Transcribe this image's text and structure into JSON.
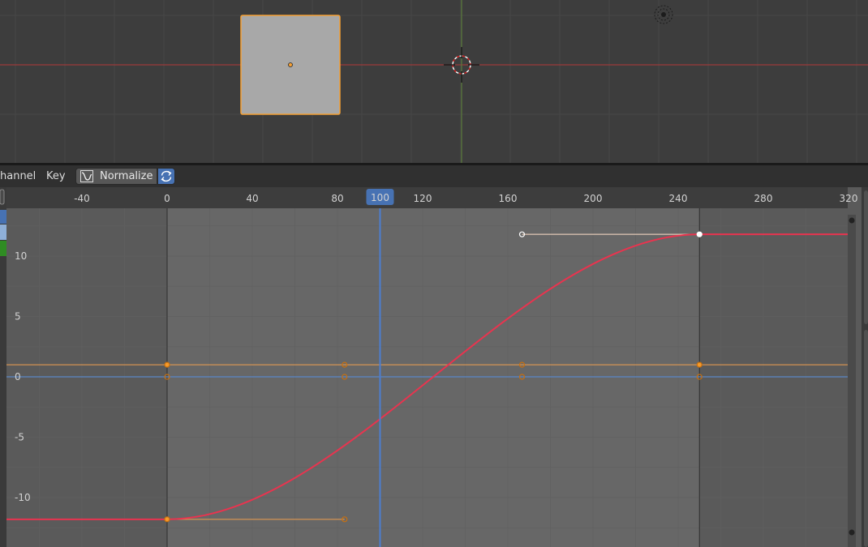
{
  "header": {
    "menu_channel": "hannel",
    "menu_key": "Key",
    "normalize_label": "Normalize"
  },
  "graph": {
    "current_frame": "100",
    "frame_ticks": [
      "-40",
      "0",
      "40",
      "80",
      "120",
      "160",
      "200",
      "240",
      "280",
      "320"
    ],
    "value_ticks": [
      "10",
      "5",
      "0",
      "-5",
      "-10"
    ],
    "scene_range": {
      "start": 0,
      "end": 250
    },
    "fcurve": {
      "color": "#e8344f",
      "keyframes": [
        {
          "frame": 0,
          "value": -11.8
        },
        {
          "frame": 250,
          "value": 11.8
        }
      ]
    }
  },
  "colors": {
    "accent": "#4772b3",
    "selection": "#f5a034",
    "x_axis": "#9b3b3b",
    "y_axis": "#5b7a3a"
  }
}
